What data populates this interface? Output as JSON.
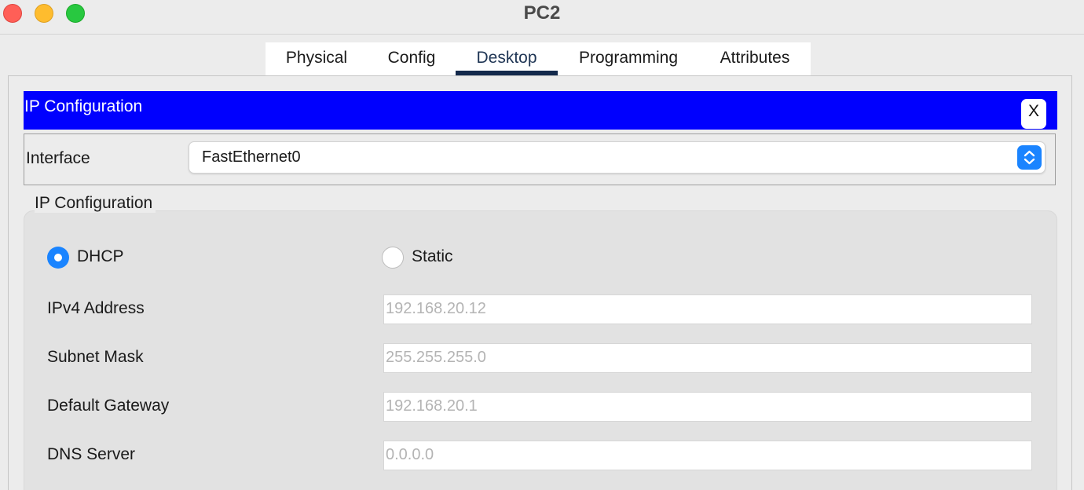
{
  "window": {
    "title": "PC2"
  },
  "tabs": [
    {
      "label": "Physical",
      "active": false
    },
    {
      "label": "Config",
      "active": false
    },
    {
      "label": "Desktop",
      "active": true
    },
    {
      "label": "Programming",
      "active": false
    },
    {
      "label": "Attributes",
      "active": false
    }
  ],
  "ip_config": {
    "header_title": "IP Configuration",
    "close_label": "X",
    "interface": {
      "label": "Interface",
      "selected": "FastEthernet0"
    },
    "group_title": "IP Configuration",
    "mode": {
      "dhcp_label": "DHCP",
      "static_label": "Static",
      "selected": "DHCP"
    },
    "fields": {
      "ipv4": {
        "label": "IPv4 Address",
        "value": "192.168.20.12"
      },
      "subnet": {
        "label": "Subnet Mask",
        "value": "255.255.255.0"
      },
      "gateway": {
        "label": "Default Gateway",
        "value": "192.168.20.1"
      },
      "dns": {
        "label": "DNS Server",
        "value": "0.0.0.0"
      }
    }
  },
  "colors": {
    "header_bar": "#0000fe",
    "active_tab_indicator": "#13294b",
    "accent": "#1a84ff",
    "close_traffic": "#ff5f57",
    "minimize_traffic": "#febc2e",
    "maximize_traffic": "#28c840"
  },
  "icons": {
    "close_window": "traffic-light-red",
    "minimize_window": "traffic-light-yellow",
    "maximize_window": "traffic-light-green",
    "select_stepper": "chevron-up-down-icon"
  }
}
